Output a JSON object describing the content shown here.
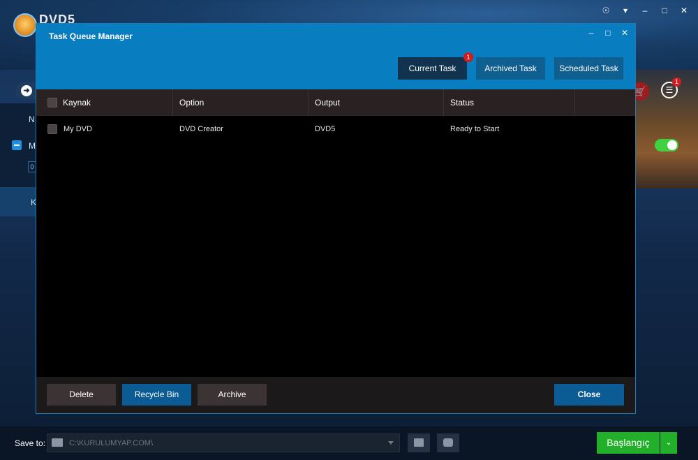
{
  "app": {
    "logo_text": "DVD5",
    "window_controls": [
      "☉",
      "▾",
      "–",
      "□",
      "✕"
    ],
    "sidebar": {
      "n_letter": "N",
      "m_letter": "M",
      "zero_box": "0",
      "k_letter": "K"
    },
    "list_badge": "1",
    "save_to_label": "Save to:",
    "save_path": "C:\\KURULUMYAP.COM\\",
    "start_button": "Başlangıç",
    "start_arrow": "⌄"
  },
  "dialog": {
    "title": "Task Queue Manager",
    "window_controls": [
      "–",
      "□",
      "✕"
    ],
    "tabs": [
      {
        "label": "Current Task",
        "badge": "1",
        "active": true
      },
      {
        "label": "Archived Task",
        "active": false
      },
      {
        "label": "Scheduled Task",
        "active": false
      }
    ],
    "columns": [
      "Kaynak",
      "Option",
      "Output",
      "Status"
    ],
    "rows": [
      {
        "source": "My DVD",
        "option": "DVD Creator",
        "output": "DVD5",
        "status": "Ready to Start",
        "checked": false
      }
    ],
    "footer": {
      "delete_label": "Delete",
      "recycle_label": "Recycle Bin",
      "archive_label": "Archive",
      "close_label": "Close"
    }
  },
  "colors": {
    "dialog_header": "#087dbf",
    "active_tab": "#12334f",
    "primary_button": "#0b5c95",
    "start_button": "#22b02a",
    "badge": "#d11d1d"
  }
}
